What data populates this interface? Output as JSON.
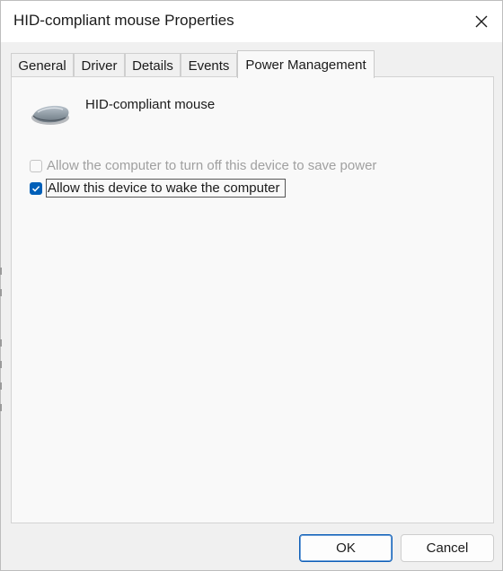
{
  "window": {
    "title": "HID-compliant mouse Properties",
    "close_icon": "close-icon"
  },
  "tabs": [
    {
      "label": "General",
      "active": false
    },
    {
      "label": "Driver",
      "active": false
    },
    {
      "label": "Details",
      "active": false
    },
    {
      "label": "Events",
      "active": false
    },
    {
      "label": "Power Management",
      "active": true
    }
  ],
  "device": {
    "icon": "mouse-icon",
    "name": "HID-compliant mouse"
  },
  "options": [
    {
      "label": "Allow the computer to turn off this device to save power",
      "checked": false,
      "enabled": false
    },
    {
      "label": "Allow this device to wake the computer",
      "checked": true,
      "enabled": true
    }
  ],
  "buttons": {
    "ok": "OK",
    "cancel": "Cancel"
  },
  "colors": {
    "accent": "#005fb8",
    "disabled_text": "#a0a0a0"
  }
}
